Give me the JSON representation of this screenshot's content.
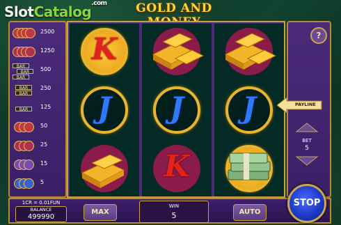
{
  "watermark": {
    "part1": "Slot",
    "part2": "Catalog",
    "suffix": ".com"
  },
  "title": "GOLD AND MONEY",
  "paytable": [
    {
      "value": "2500"
    },
    {
      "value": "1250"
    },
    {
      "value": "500"
    },
    {
      "value": "250"
    },
    {
      "value": "125"
    },
    {
      "value": "50"
    },
    {
      "value": "25"
    },
    {
      "value": "15"
    },
    {
      "value": "5"
    }
  ],
  "bar_label": "BAR",
  "reels": [
    {
      "symbols": [
        "K",
        "J",
        "gold-bars"
      ]
    },
    {
      "symbols": [
        "gold-bars",
        "J",
        "K"
      ]
    },
    {
      "symbols": [
        "gold-bars",
        "J",
        "money-stack"
      ]
    }
  ],
  "colors": {
    "K": "#e0231c",
    "J": "#2f79ff",
    "gold": "#e8b52e",
    "panel": "#4b2b7a"
  },
  "right_panel": {
    "help": "?",
    "payline": "PAYLINE",
    "bet_label": "BET",
    "bet_value": "5"
  },
  "bottom": {
    "cr": "1CR = 0.01FUN",
    "balance_label": "BALANCE",
    "balance_value": "499990",
    "max": "MAX",
    "win_label": "WIN",
    "win_value": "5",
    "auto": "AUTO",
    "stop": "STOP"
  }
}
